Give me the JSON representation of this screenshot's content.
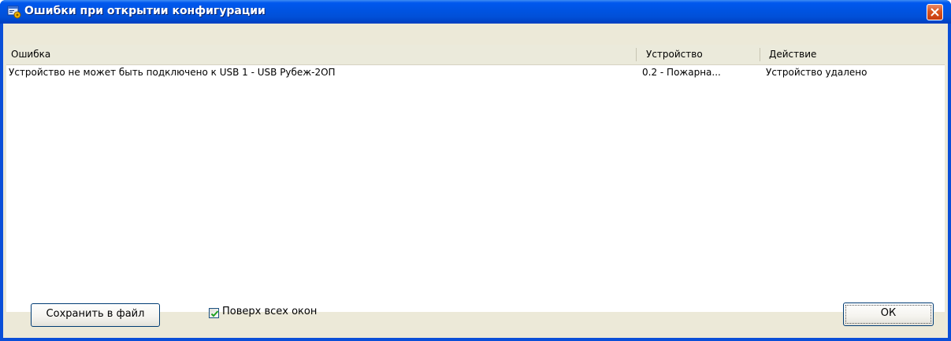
{
  "window": {
    "title": "Ошибки при открытии конфигурации",
    "icon": "config-gear-icon",
    "close_icon": "close-icon"
  },
  "list": {
    "columns": [
      "Ошибка",
      "Устройство",
      "Действие"
    ],
    "rows": [
      {
        "error": "Устройство не может быть подключено к USB 1 - USB Рубеж-2ОП",
        "device": "0.2 - Пожарна...",
        "action": "Устройство удалено"
      }
    ]
  },
  "footer": {
    "save_label": "Сохранить в файл",
    "on_top_label": "Поверх всех окон",
    "on_top_checked": true,
    "ok_label": "ОК"
  },
  "colors": {
    "titlebar": "#0054e3",
    "close_button": "#d9541e",
    "dialog_background": "#ece9d8"
  }
}
